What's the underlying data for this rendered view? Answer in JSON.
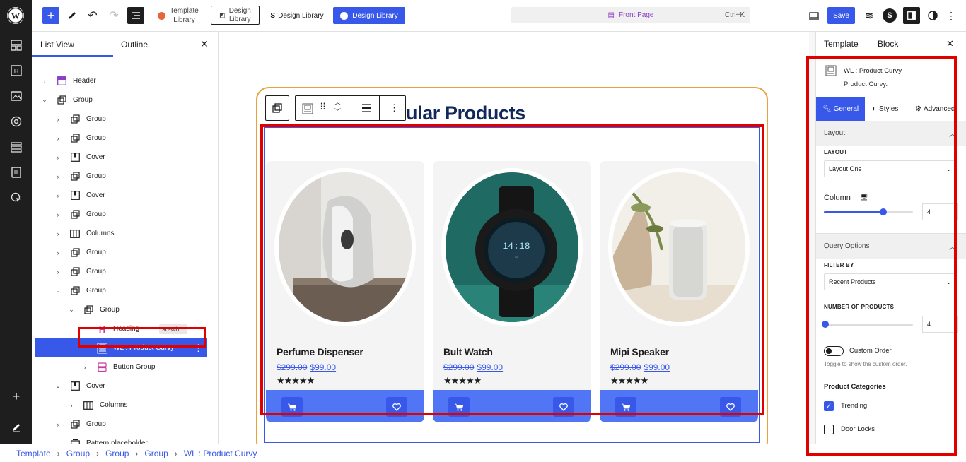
{
  "topbar": {
    "template_library_line1": "Template",
    "template_library_line2": "Library",
    "design_library_outline_line1": "Design",
    "design_library_outline_line2": "Library",
    "design_library_1": "Design Library",
    "design_library_2": "Design Library",
    "command_title": "Front Page",
    "command_shortcut": "Ctrl+K",
    "save": "Save"
  },
  "listview": {
    "tab_list": "List View",
    "tab_outline": "Outline",
    "items": [
      {
        "label": "Header",
        "icon": "header-icon"
      },
      {
        "label": "Group",
        "icon": "group-icon"
      },
      {
        "label": "Group",
        "icon": "group-icon"
      },
      {
        "label": "Group",
        "icon": "group-icon"
      },
      {
        "label": "Cover",
        "icon": "cover-icon"
      },
      {
        "label": "Group",
        "icon": "group-icon"
      },
      {
        "label": "Cover",
        "icon": "cover-icon"
      },
      {
        "label": "Group",
        "icon": "group-icon"
      },
      {
        "label": "Columns",
        "icon": "columns-icon"
      },
      {
        "label": "Group",
        "icon": "group-icon"
      },
      {
        "label": "Group",
        "icon": "group-icon"
      },
      {
        "label": "Group",
        "icon": "group-icon"
      },
      {
        "label": "Group",
        "icon": "group-icon"
      },
      {
        "label": "Heading",
        "icon": "heading-icon",
        "badge": "so-wh..."
      },
      {
        "label": "WL : Product Curvy",
        "icon": "product-block-icon"
      },
      {
        "label": "Button Group",
        "icon": "button-group-icon"
      },
      {
        "label": "Cover",
        "icon": "cover-icon"
      },
      {
        "label": "Columns",
        "icon": "columns-icon"
      },
      {
        "label": "Group",
        "icon": "group-icon"
      },
      {
        "label": "Pattern placeholder",
        "icon": "pattern-icon"
      }
    ]
  },
  "canvas": {
    "heading_visible": "ular Products",
    "products": [
      {
        "name": "Perfume Dispenser",
        "old_price": "$299.00",
        "new_price": "$99.00",
        "stars": "★★★★★"
      },
      {
        "name": "Bult Watch",
        "old_price": "$299.00",
        "new_price": "$99.00",
        "stars": "★★★★★"
      },
      {
        "name": "Mipi Speaker",
        "old_price": "$299.00",
        "new_price": "$99.00",
        "stars": "★★★★★"
      }
    ],
    "watch_time_1": "14:18"
  },
  "inspector": {
    "tab_template": "Template",
    "tab_block": "Block",
    "block_title": "WL : Product Curvy",
    "block_desc": "Product Curvy.",
    "tab_general": "General",
    "tab_styles": "Styles",
    "tab_advanced": "Advanced",
    "layout_section": "Layout",
    "layout_label": "LAYOUT",
    "layout_value": "Layout One",
    "column_label": "Column",
    "column_value": "4",
    "column_fraction": 0.67,
    "query_section": "Query Options",
    "filter_label": "FILTER BY",
    "filter_value": "Recent Products",
    "number_label": "NUMBER OF PRODUCTS",
    "number_value": "4",
    "number_fraction": 0.0,
    "custom_order_label": "Custom Order",
    "custom_order_help": "Toggle to show the custom order.",
    "categories_label": "Product Categories",
    "cat_trending": "Trending",
    "cat_doorlocks": "Door Locks"
  },
  "breadcrumb": [
    "Template",
    "Group",
    "Group",
    "Group",
    "WL : Product Curvy"
  ],
  "colors": {
    "accent": "#3858e9",
    "highlight": "#e00000",
    "dark": "#1e1e1e",
    "card_bar": "#5076f6"
  }
}
